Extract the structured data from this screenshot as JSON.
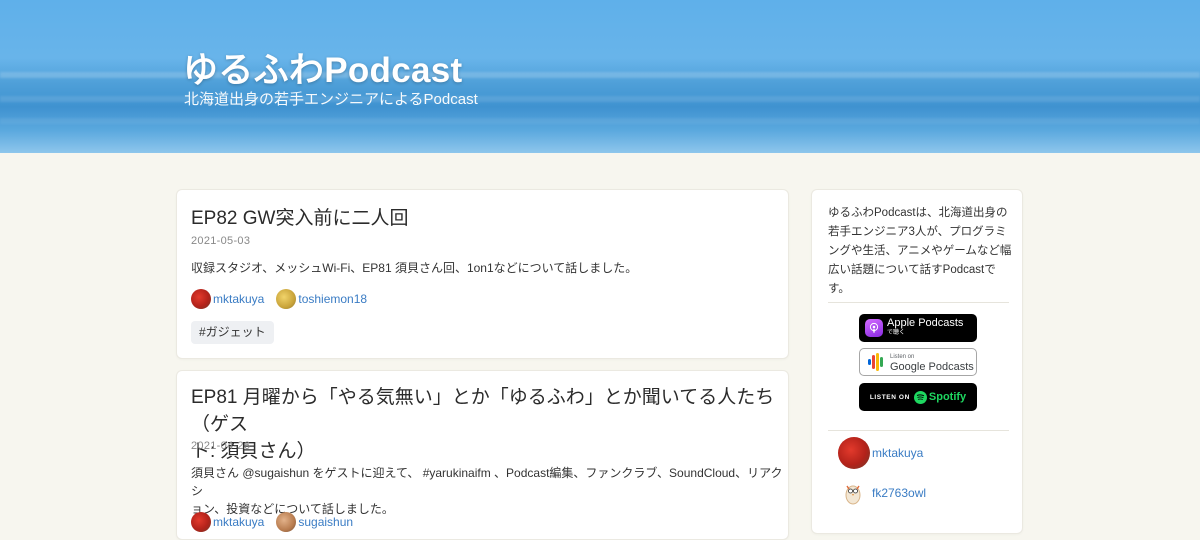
{
  "header": {
    "title": "ゆるふわPodcast",
    "subtitle": "北海道出身の若手エンジニアによるPodcast"
  },
  "episodes": [
    {
      "title": "EP82 GW突入前に二人回",
      "date": "2021-05-03",
      "description": "収録スタジオ、メッシュWi-Fi、EP81 須貝さん回、1on1などについて話しました。",
      "people": [
        "mktakuya",
        "toshiemon18"
      ],
      "tag": "#ガジェット"
    },
    {
      "title_line1": "EP81 月曜から「やる気無い」とか「ゆるふわ」とか聞いてる人たち（ゲス",
      "title_line2": "ト: 須貝さん）",
      "date": "2021-04-26",
      "description_line1": "須貝さん @sugaishun をゲストに迎えて、 #yarukinaifm 、Podcast編集、ファンクラブ、SoundCloud、リアクシ",
      "description_line2": "ョン、投資などについて話しました。",
      "people": [
        "mktakuya",
        "sugaishun"
      ]
    }
  ],
  "sidebar": {
    "description": "ゆるふわPodcastは、北海道出身の若手エンジニア3人が、プログラミングや生活、アニメやゲームなど幅広い話題について話すPodcastです。",
    "badges": {
      "apple_line1": "Apple Podcasts",
      "apple_line2": "で聴く",
      "google_line1": "Listen on",
      "google_line2": "Google Podcasts",
      "spotify_prefix": "LISTEN ON",
      "spotify_word": "Spotify"
    },
    "members": [
      "mktakuya",
      "fk2763owl"
    ]
  },
  "colors": {
    "link": "#3a7cc4",
    "page_bg": "#f7f6ef",
    "tag_bg": "#eef0f3",
    "spotify_green": "#1ed760"
  }
}
